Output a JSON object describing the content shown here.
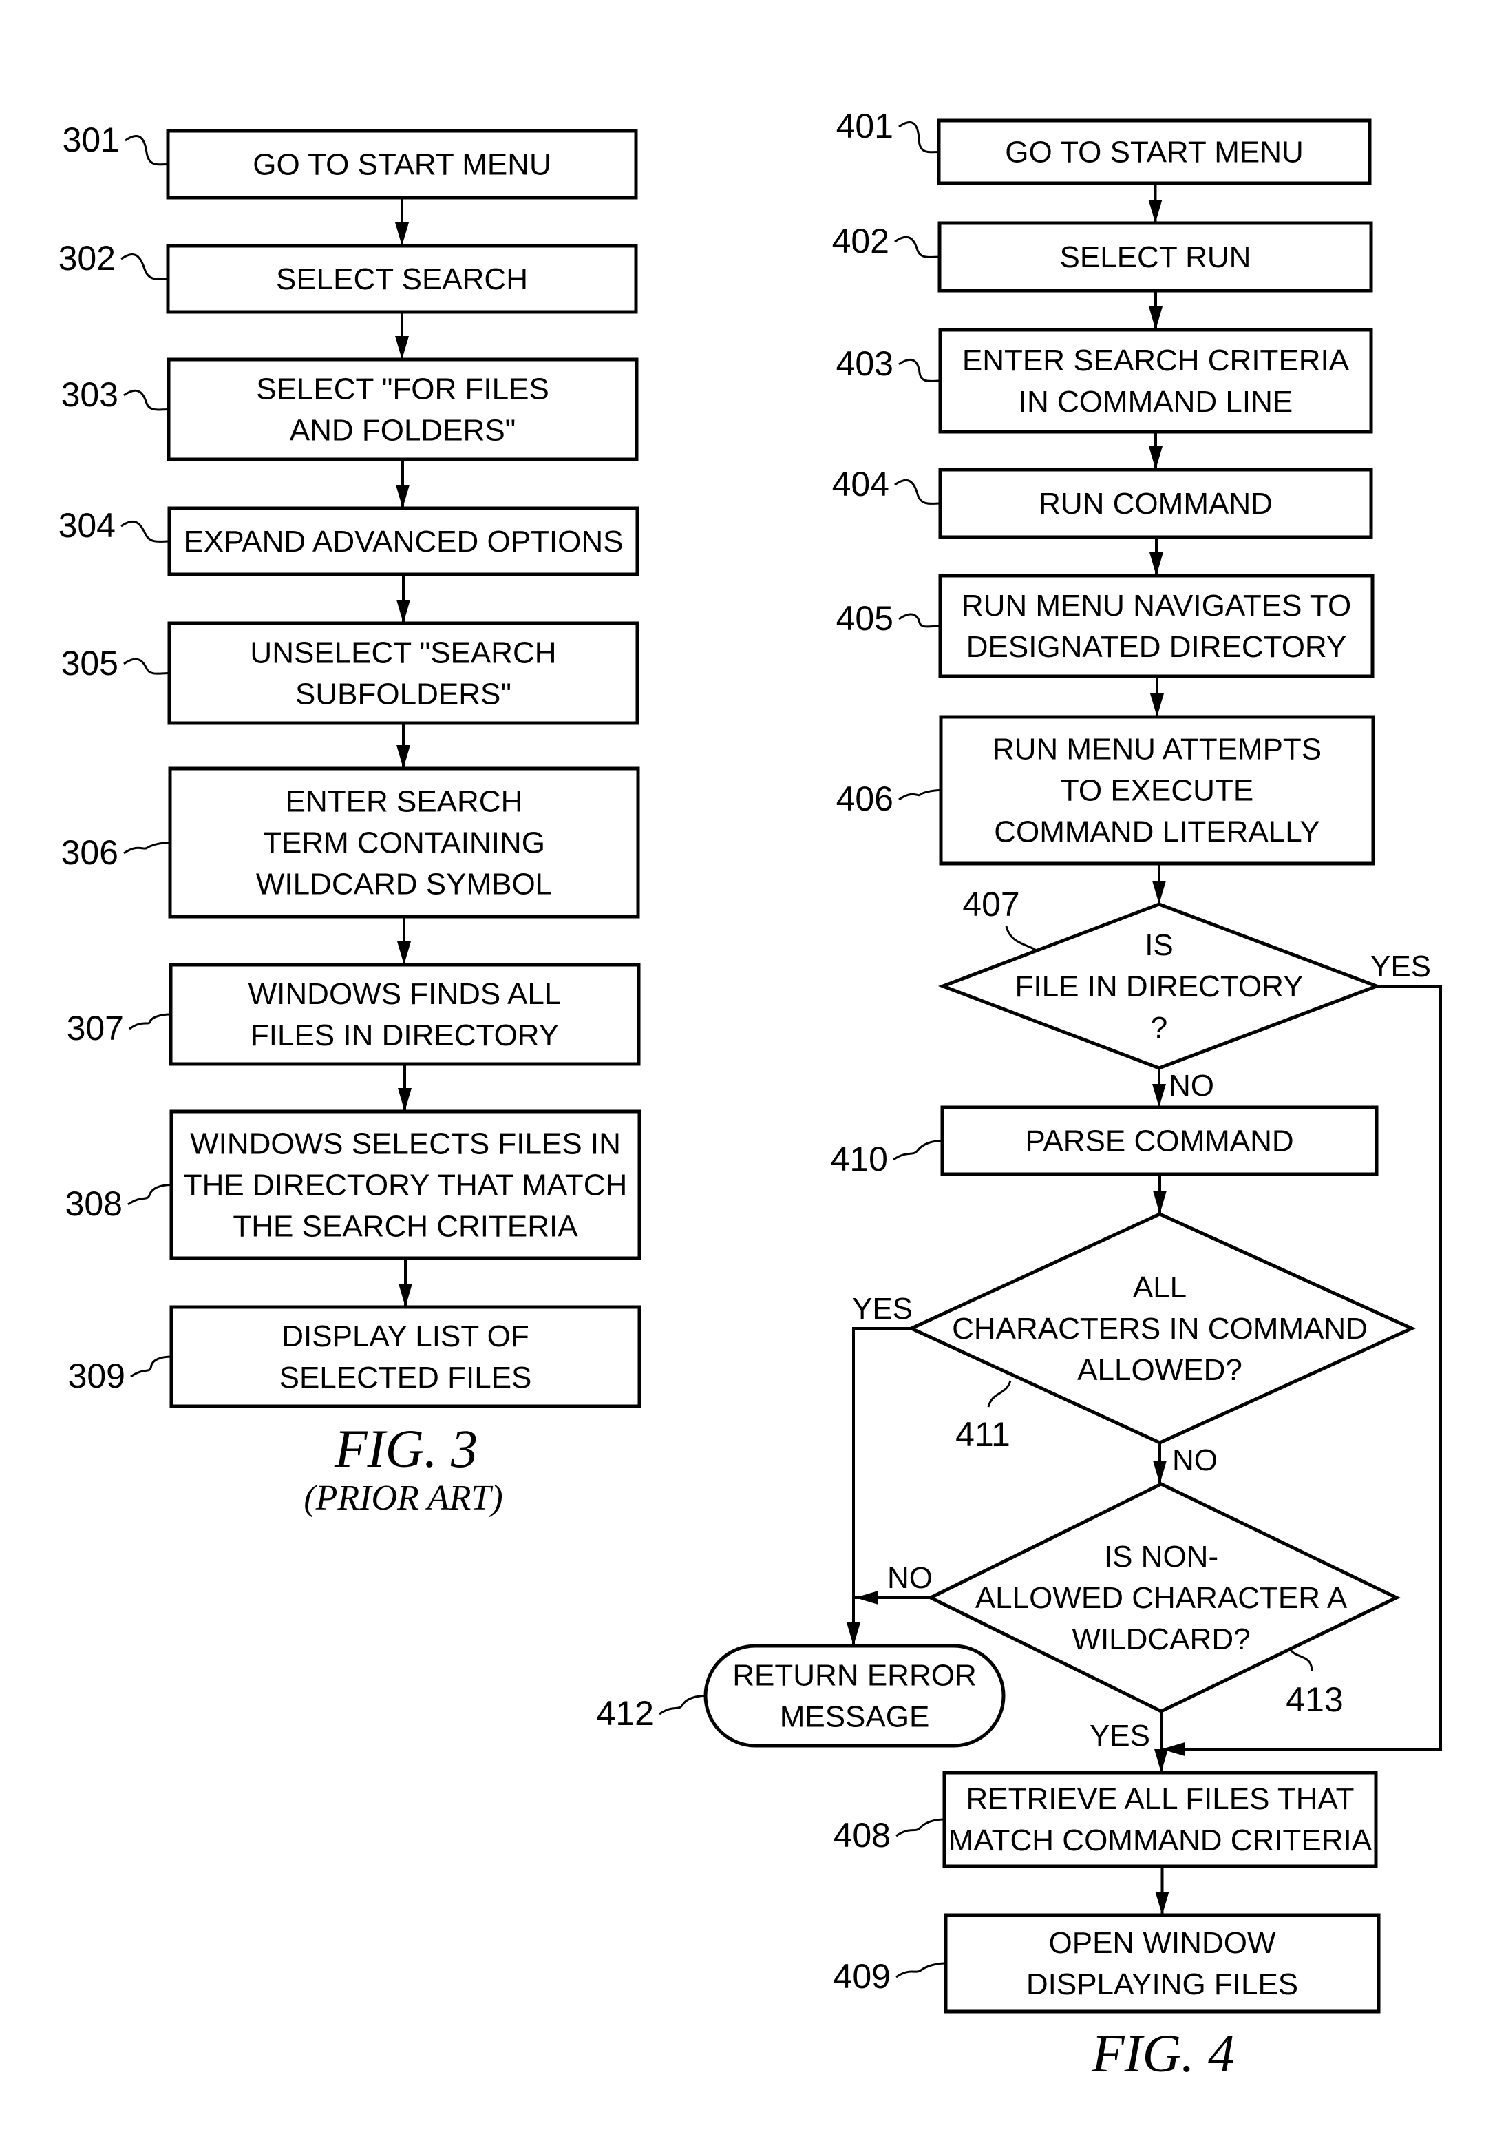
{
  "figures": [
    {
      "id": "fig3",
      "title": "FIG. 3",
      "subtitle": "(PRIOR ART)",
      "steps": [
        {
          "ref": "301",
          "type": "process",
          "lines": [
            "GO TO START MENU"
          ]
        },
        {
          "ref": "302",
          "type": "process",
          "lines": [
            "SELECT SEARCH"
          ]
        },
        {
          "ref": "303",
          "type": "process",
          "lines": [
            "SELECT \"FOR FILES",
            "AND FOLDERS\""
          ]
        },
        {
          "ref": "304",
          "type": "process",
          "lines": [
            "EXPAND ADVANCED OPTIONS"
          ]
        },
        {
          "ref": "305",
          "type": "process",
          "lines": [
            "UNSELECT \"SEARCH",
            "SUBFOLDERS\""
          ]
        },
        {
          "ref": "306",
          "type": "process",
          "lines": [
            "ENTER SEARCH",
            "TERM CONTAINING",
            "WILDCARD SYMBOL"
          ]
        },
        {
          "ref": "307",
          "type": "process",
          "lines": [
            "WINDOWS FINDS ALL",
            "FILES IN DIRECTORY"
          ]
        },
        {
          "ref": "308",
          "type": "process",
          "lines": [
            "WINDOWS SELECTS FILES IN",
            "THE DIRECTORY THAT MATCH",
            "THE SEARCH CRITERIA"
          ]
        },
        {
          "ref": "309",
          "type": "process",
          "lines": [
            "DISPLAY LIST OF",
            "SELECTED FILES"
          ]
        }
      ],
      "edges": [
        {
          "from": "301",
          "to": "302"
        },
        {
          "from": "302",
          "to": "303"
        },
        {
          "from": "303",
          "to": "304"
        },
        {
          "from": "304",
          "to": "305"
        },
        {
          "from": "305",
          "to": "306"
        },
        {
          "from": "306",
          "to": "307"
        },
        {
          "from": "307",
          "to": "308"
        },
        {
          "from": "308",
          "to": "309"
        }
      ]
    },
    {
      "id": "fig4",
      "title": "FIG. 4",
      "subtitle": "",
      "steps": [
        {
          "ref": "401",
          "type": "process",
          "lines": [
            "GO TO START MENU"
          ]
        },
        {
          "ref": "402",
          "type": "process",
          "lines": [
            "SELECT RUN"
          ]
        },
        {
          "ref": "403",
          "type": "process",
          "lines": [
            "ENTER SEARCH CRITERIA",
            "IN COMMAND LINE"
          ]
        },
        {
          "ref": "404",
          "type": "process",
          "lines": [
            "RUN COMMAND"
          ]
        },
        {
          "ref": "405",
          "type": "process",
          "lines": [
            "RUN MENU NAVIGATES TO",
            "DESIGNATED DIRECTORY"
          ]
        },
        {
          "ref": "406",
          "type": "process",
          "lines": [
            "RUN MENU ATTEMPTS",
            "TO EXECUTE",
            "COMMAND LITERALLY"
          ]
        },
        {
          "ref": "407",
          "type": "decision",
          "lines": [
            "IS",
            "FILE IN DIRECTORY",
            "?"
          ]
        },
        {
          "ref": "410",
          "type": "process",
          "lines": [
            "PARSE COMMAND"
          ]
        },
        {
          "ref": "411",
          "type": "decision",
          "lines": [
            "ALL",
            "CHARACTERS IN COMMAND",
            "ALLOWED?"
          ]
        },
        {
          "ref": "413",
          "type": "decision",
          "lines": [
            "IS NON-",
            "ALLOWED CHARACTER A",
            "WILDCARD?"
          ]
        },
        {
          "ref": "412",
          "type": "terminal",
          "lines": [
            "RETURN ERROR",
            "MESSAGE"
          ]
        },
        {
          "ref": "408",
          "type": "process",
          "lines": [
            "RETRIEVE ALL FILES THAT",
            "MATCH COMMAND CRITERIA"
          ]
        },
        {
          "ref": "409",
          "type": "process",
          "lines": [
            "OPEN WINDOW",
            "DISPLAYING FILES"
          ]
        }
      ],
      "edges": [
        {
          "from": "401",
          "to": "402",
          "label": ""
        },
        {
          "from": "402",
          "to": "403",
          "label": ""
        },
        {
          "from": "403",
          "to": "404",
          "label": ""
        },
        {
          "from": "404",
          "to": "405",
          "label": ""
        },
        {
          "from": "405",
          "to": "406",
          "label": ""
        },
        {
          "from": "406",
          "to": "407",
          "label": ""
        },
        {
          "from": "407",
          "to": "410",
          "label": "NO"
        },
        {
          "from": "407",
          "to": "408",
          "label": "YES"
        },
        {
          "from": "410",
          "to": "411",
          "label": ""
        },
        {
          "from": "411",
          "to": "412",
          "label": "YES"
        },
        {
          "from": "411",
          "to": "413",
          "label": "NO"
        },
        {
          "from": "413",
          "to": "412",
          "label": "NO"
        },
        {
          "from": "413",
          "to": "408",
          "label": "YES"
        },
        {
          "from": "408",
          "to": "409",
          "label": ""
        }
      ]
    }
  ]
}
